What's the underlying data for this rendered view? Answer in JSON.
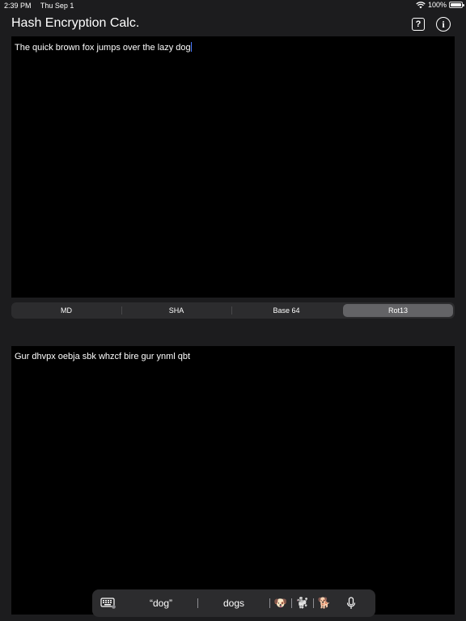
{
  "status_bar": {
    "time": "2:39 PM",
    "date": "Thu Sep 1",
    "battery": "100%"
  },
  "navbar": {
    "title": "Hash Encryption Calc.",
    "help_icon": "question-square-icon",
    "info_icon": "info-circle-icon"
  },
  "input": {
    "text": "The quick brown fox jumps over the lazy dog"
  },
  "segments": [
    {
      "label": "MD",
      "selected": false
    },
    {
      "label": "SHA",
      "selected": false
    },
    {
      "label": "Base 64",
      "selected": false
    },
    {
      "label": "Rot13",
      "selected": true
    }
  ],
  "output": {
    "text": "Gur dhvpx oebja sbk whzcf bire gur ynml qbt"
  },
  "keyboard_bar": {
    "suggestions": [
      "“dog”",
      "dogs"
    ],
    "emojis": [
      "🐶",
      "🐩",
      "🐕"
    ],
    "keyboard_icon": "keyboard-icon",
    "mic_icon": "microphone-icon"
  },
  "colors": {
    "background": "#1c1c1e",
    "text_area": "#000000",
    "accent_caret": "#4a7bff",
    "segment_selected": "#636366"
  }
}
